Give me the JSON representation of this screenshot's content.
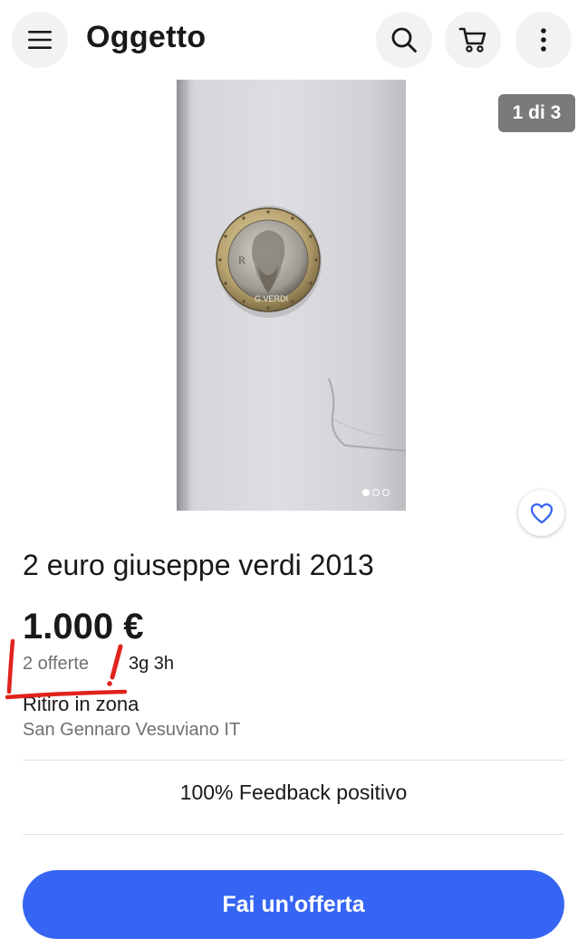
{
  "header": {
    "title": "Oggetto",
    "menu_icon": "hamburger-menu-icon",
    "search_icon": "search-icon",
    "cart_icon": "cart-icon",
    "more_icon": "more-vertical-icon"
  },
  "gallery": {
    "counter": "1 di 3",
    "total_images": 3,
    "active_index": 1,
    "image_description_icon": "coin-photo",
    "coin_inscription": "G.VERDI",
    "watch_icon": "heart-icon"
  },
  "listing": {
    "title": "2 euro giuseppe verdi 2013",
    "price": "1.000 €",
    "bids": "2 offerte",
    "time_left": "3g 3h",
    "pickup": "Ritiro in zona",
    "location": "San Gennaro Vesuviano  IT"
  },
  "seller": {
    "feedback": "100% Feedback positivo"
  },
  "actions": {
    "offer_label": "Fai un'offerta"
  },
  "colors": {
    "accent": "#3665f3",
    "annotation": "#e0231c",
    "counter_bg": "#7a7a7a"
  }
}
